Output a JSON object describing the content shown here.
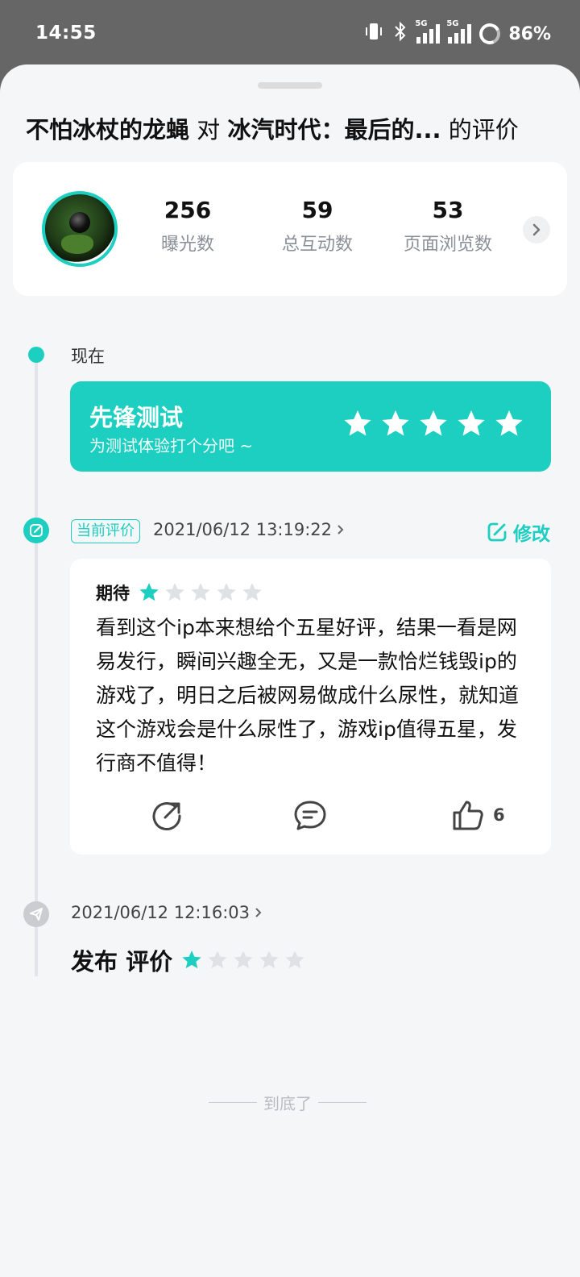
{
  "status_bar": {
    "time": "14:55",
    "battery": "86%",
    "network_1": "5G",
    "network_2": "5G"
  },
  "header": {
    "user": "不怕冰杖的龙蝇",
    "connector": "对",
    "game": "冰汽时代：最后的...",
    "suffix": "的评价"
  },
  "stats": [
    {
      "value": "256",
      "label": "曝光数"
    },
    {
      "value": "59",
      "label": "总互动数"
    },
    {
      "value": "53",
      "label": "页面浏览数"
    }
  ],
  "timeline": {
    "now_label": "现在",
    "pioneer": {
      "title": "先锋测试",
      "subtitle": "为测试体验打个分吧 ~",
      "stars_total": 5
    },
    "current": {
      "tag": "当前评价",
      "time": "2021/06/12 13:19:22",
      "modify_label": "修改",
      "review": {
        "label": "期待",
        "rating": 1,
        "out_of": 5,
        "text": "看到这个ip本来想给个五星好评，结果一看是网易发行，瞬间兴趣全无，又是一款恰烂钱毁ip的游戏了，明日之后被网易做成什么尿性，就知道这个游戏会是什么尿性了，游戏ip值得五星，发行商不值得！",
        "likes": "6"
      }
    },
    "published": {
      "time": "2021/06/12 12:16:03",
      "text": "发布 评价",
      "rating": 1,
      "out_of": 5
    }
  },
  "footer": {
    "end_text": "到底了"
  },
  "colors": {
    "accent": "#1ccfc0",
    "star_empty": "#dfe1e5",
    "background": "#f5f6f8"
  }
}
